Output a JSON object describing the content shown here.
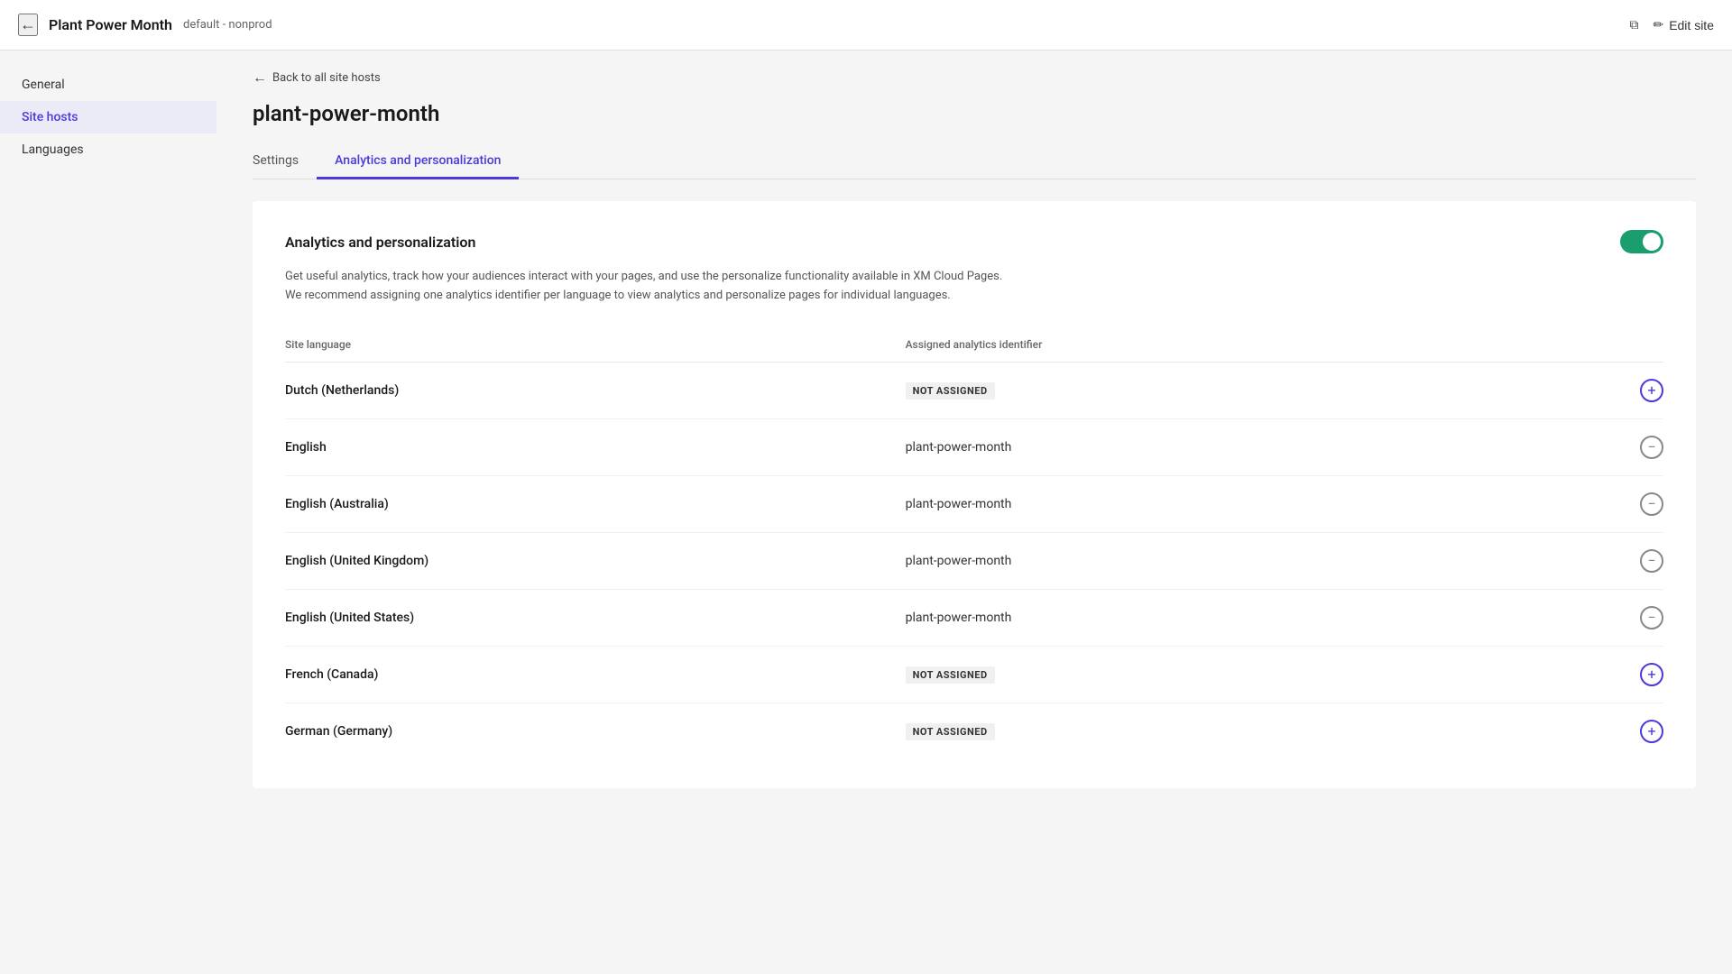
{
  "topbar": {
    "back_label": "←",
    "app_title": "Plant Power Month",
    "app_subtitle": "default - nonprod",
    "copy_icon": "⧉",
    "edit_site_label": "Edit site",
    "edit_icon": "✏"
  },
  "sidebar": {
    "items": [
      {
        "label": "General",
        "id": "general",
        "active": false
      },
      {
        "label": "Site hosts",
        "id": "site-hosts",
        "active": true
      },
      {
        "label": "Languages",
        "id": "languages",
        "active": false
      }
    ]
  },
  "main": {
    "back_link_text": "Back to all site hosts",
    "page_title": "plant-power-month",
    "tabs": [
      {
        "label": "Settings",
        "active": false
      },
      {
        "label": "Analytics and personalization",
        "active": true
      }
    ],
    "card": {
      "title": "Analytics and personalization",
      "toggle_on": true,
      "description_line1": "Get useful analytics, track how your audiences interact with your pages, and use the personalize functionality available in XM Cloud Pages.",
      "description_line2": "We recommend assigning one analytics identifier per language to view analytics and personalize pages for individual languages.",
      "table": {
        "col_language": "Site language",
        "col_identifier": "Assigned analytics identifier",
        "rows": [
          {
            "language": "Dutch (Netherlands)",
            "identifier": null,
            "identifier_badge": "NOT ASSIGNED",
            "action": "add"
          },
          {
            "language": "English",
            "identifier": "plant-power-month",
            "identifier_badge": null,
            "action": "remove"
          },
          {
            "language": "English (Australia)",
            "identifier": "plant-power-month",
            "identifier_badge": null,
            "action": "remove"
          },
          {
            "language": "English (United Kingdom)",
            "identifier": "plant-power-month",
            "identifier_badge": null,
            "action": "remove"
          },
          {
            "language": "English (United States)",
            "identifier": "plant-power-month",
            "identifier_badge": null,
            "action": "remove"
          },
          {
            "language": "French (Canada)",
            "identifier": null,
            "identifier_badge": "NOT ASSIGNED",
            "action": "add"
          },
          {
            "language": "German (Germany)",
            "identifier": null,
            "identifier_badge": "NOT ASSIGNED",
            "action": "add"
          }
        ]
      }
    }
  }
}
